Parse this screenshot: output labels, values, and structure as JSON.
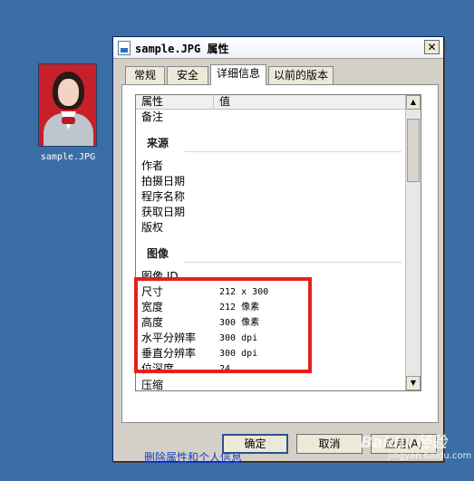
{
  "desktop": {
    "file_label": "sample.JPG"
  },
  "window": {
    "title": "sample.JPG 属性",
    "close_glyph": "✕",
    "tabs": [
      {
        "label": "常规"
      },
      {
        "label": "安全"
      },
      {
        "label": "详细信息"
      },
      {
        "label": "以前的版本"
      }
    ],
    "active_tab": "详细信息",
    "list": {
      "columns": [
        "属性",
        "值"
      ],
      "rows_top": [
        {
          "name": "备注",
          "value": ""
        }
      ],
      "section_source": "来源",
      "rows_source": [
        {
          "name": "作者",
          "value": ""
        },
        {
          "name": "拍摄日期",
          "value": ""
        },
        {
          "name": "程序名称",
          "value": ""
        },
        {
          "name": "获取日期",
          "value": ""
        },
        {
          "name": "版权",
          "value": ""
        }
      ],
      "section_image": "图像",
      "rows_image": [
        {
          "name": "图像 ID",
          "value": ""
        },
        {
          "name": "尺寸",
          "value": "212 x 300"
        },
        {
          "name": "宽度",
          "value": "212 像素"
        },
        {
          "name": "高度",
          "value": "300 像素"
        },
        {
          "name": "水平分辨率",
          "value": "300 dpi"
        },
        {
          "name": "垂直分辨率",
          "value": "300 dpi"
        },
        {
          "name": "位深度",
          "value": "24"
        },
        {
          "name": "压缩",
          "value": ""
        }
      ],
      "scroll_up": "▲",
      "scroll_down": "▼"
    },
    "remove_link": "删除属性和个人信息",
    "buttons": {
      "ok": "确定",
      "cancel": "取消",
      "apply": "应用(A)"
    },
    "highlight_color": "#e2231a"
  },
  "watermark": {
    "brand": "Baidu 经验",
    "url": "jingyan.baidu.com"
  }
}
